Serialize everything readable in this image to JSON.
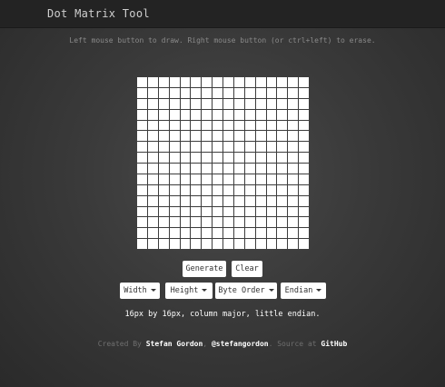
{
  "navbar": {
    "title": "Dot Matrix Tool"
  },
  "instructions": "Left mouse button to draw. Right mouse button (or ctrl+left) to erase.",
  "matrix": {
    "columns": 16,
    "rows": 16,
    "filled": []
  },
  "buttons": {
    "generate": "Generate",
    "clear": "Clear"
  },
  "dropdowns": {
    "width": "Width",
    "height": "Height",
    "byte_order": "Byte Order",
    "endian": "Endian"
  },
  "summary": "16px by 16px, column major, little endian.",
  "footer": {
    "created_by": "Created By",
    "author": "Stefan Gordon",
    "sep1": ",",
    "handle": "@stefangordon",
    "sep2": ". Source at",
    "source": "GitHub"
  }
}
